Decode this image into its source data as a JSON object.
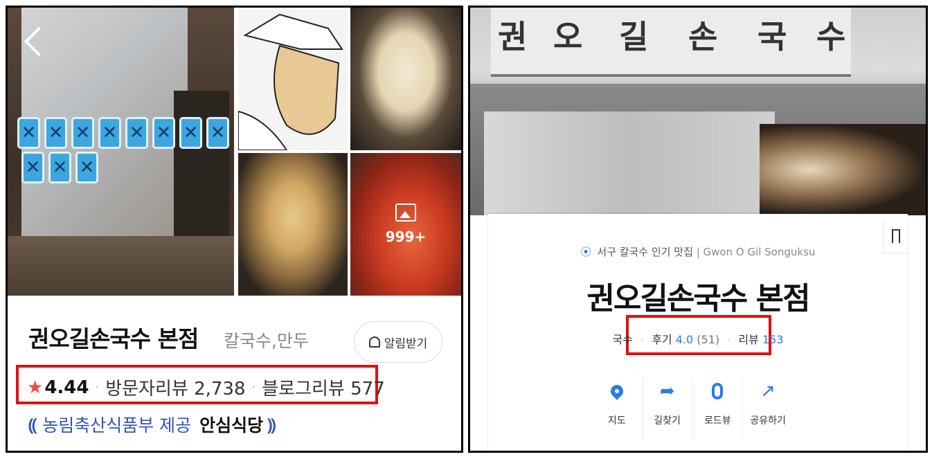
{
  "left": {
    "photos": {
      "more_count": "999+"
    },
    "store_name": "권오길손국수 본점",
    "category": "칼국수,만두",
    "alarm_button": "알림받기",
    "rating": "4.44",
    "visitor_review": "방문자리뷰 2,738",
    "blog_review": "블로그리뷰 577",
    "cert_text": "농림축산식품부 제공",
    "cert_badge": "안심식당"
  },
  "right": {
    "sign_chars": [
      "권",
      "오",
      "길",
      "손",
      "국",
      "수"
    ],
    "subtitle": "서구 칼국수 인기 맛집",
    "subtitle_en": "Gwon O Gil Songuksu",
    "store_name": "권오길손국수 본점",
    "stats": {
      "category": "국수",
      "review_label": "후기",
      "review_score": "4.0",
      "review_count": "(51)",
      "review2_label": "리뷰",
      "review2_count": "153"
    },
    "actions": [
      {
        "label": "지도",
        "icon": "map-pin-icon"
      },
      {
        "label": "길찾기",
        "icon": "directions-icon"
      },
      {
        "label": "로드뷰",
        "icon": "roadview-icon"
      },
      {
        "label": "공유하기",
        "icon": "share-icon"
      }
    ]
  },
  "colors": {
    "highlight_red": "#e01010",
    "accent_blue": "#2b7be4",
    "cert_blue": "#2f55b8",
    "star_red": "#f04b4b"
  }
}
